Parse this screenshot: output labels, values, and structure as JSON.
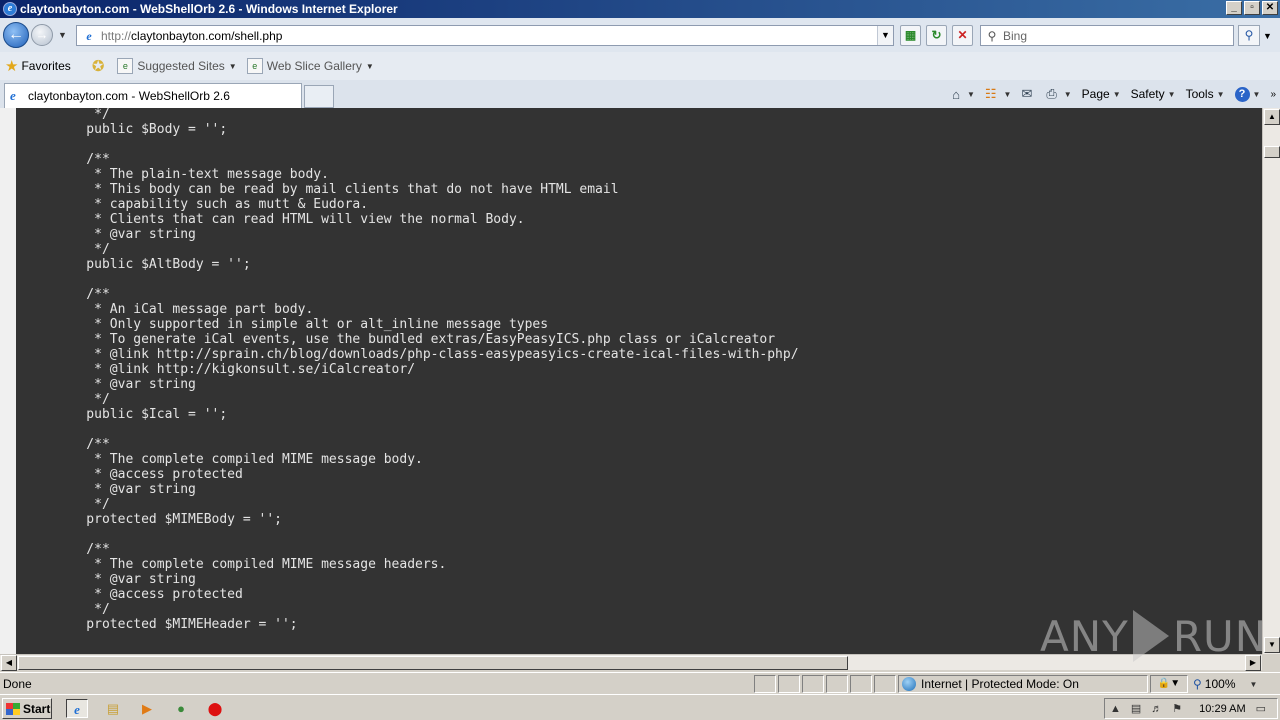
{
  "window": {
    "title": "claytonbayton.com - WebShellOrb 2.6 - Windows Internet Explorer",
    "controls": {
      "minimize": "_",
      "maximize": "▫",
      "close": "✕"
    }
  },
  "nav": {
    "address_http": "http://",
    "address_host": "claytonbayton.com/shell.php",
    "search_placeholder": "Bing"
  },
  "favorites_bar": {
    "favorites_label": "Favorites",
    "suggested_sites": "Suggested Sites",
    "web_slice_gallery": "Web Slice Gallery"
  },
  "tabs": [
    {
      "label": "claytonbayton.com - WebShellOrb 2.6",
      "active": true
    }
  ],
  "command_bar": {
    "page": "Page",
    "safety": "Safety",
    "tools": "Tools",
    "help": "?"
  },
  "content": {
    "code_lines": [
      "     */",
      "    public $Body = '';",
      "",
      "    /**",
      "     * The plain-text message body.",
      "     * This body can be read by mail clients that do not have HTML email",
      "     * capability such as mutt & Eudora.",
      "     * Clients that can read HTML will view the normal Body.",
      "     * @var string",
      "     */",
      "    public $AltBody = '';",
      "",
      "    /**",
      "     * An iCal message part body.",
      "     * Only supported in simple alt or alt_inline message types",
      "     * To generate iCal events, use the bundled extras/EasyPeasyICS.php class or iCalcreator",
      "     * @link http://sprain.ch/blog/downloads/php-class-easypeasyics-create-ical-files-with-php/",
      "     * @link http://kigkonsult.se/iCalcreator/",
      "     * @var string",
      "     */",
      "    public $Ical = '';",
      "",
      "    /**",
      "     * The complete compiled MIME message body.",
      "     * @access protected",
      "     * @var string",
      "     */",
      "    protected $MIMEBody = '';",
      "",
      "    /**",
      "     * The complete compiled MIME message headers.",
      "     * @var string",
      "     * @access protected",
      "     */",
      "    protected $MIMEHeader = '';"
    ],
    "watermark": {
      "left": "ANY",
      "right": "RUN"
    }
  },
  "status_bar": {
    "status": "Done",
    "zone": "Internet | Protected Mode: On",
    "zoom": "100%"
  },
  "taskbar": {
    "start": "Start",
    "clock": "10:29 AM"
  },
  "colors": {
    "code_background": "#333333",
    "code_text": "#e4e4e4",
    "titlebar_start": "#0a246a",
    "titlebar_end": "#3a6ea5"
  }
}
